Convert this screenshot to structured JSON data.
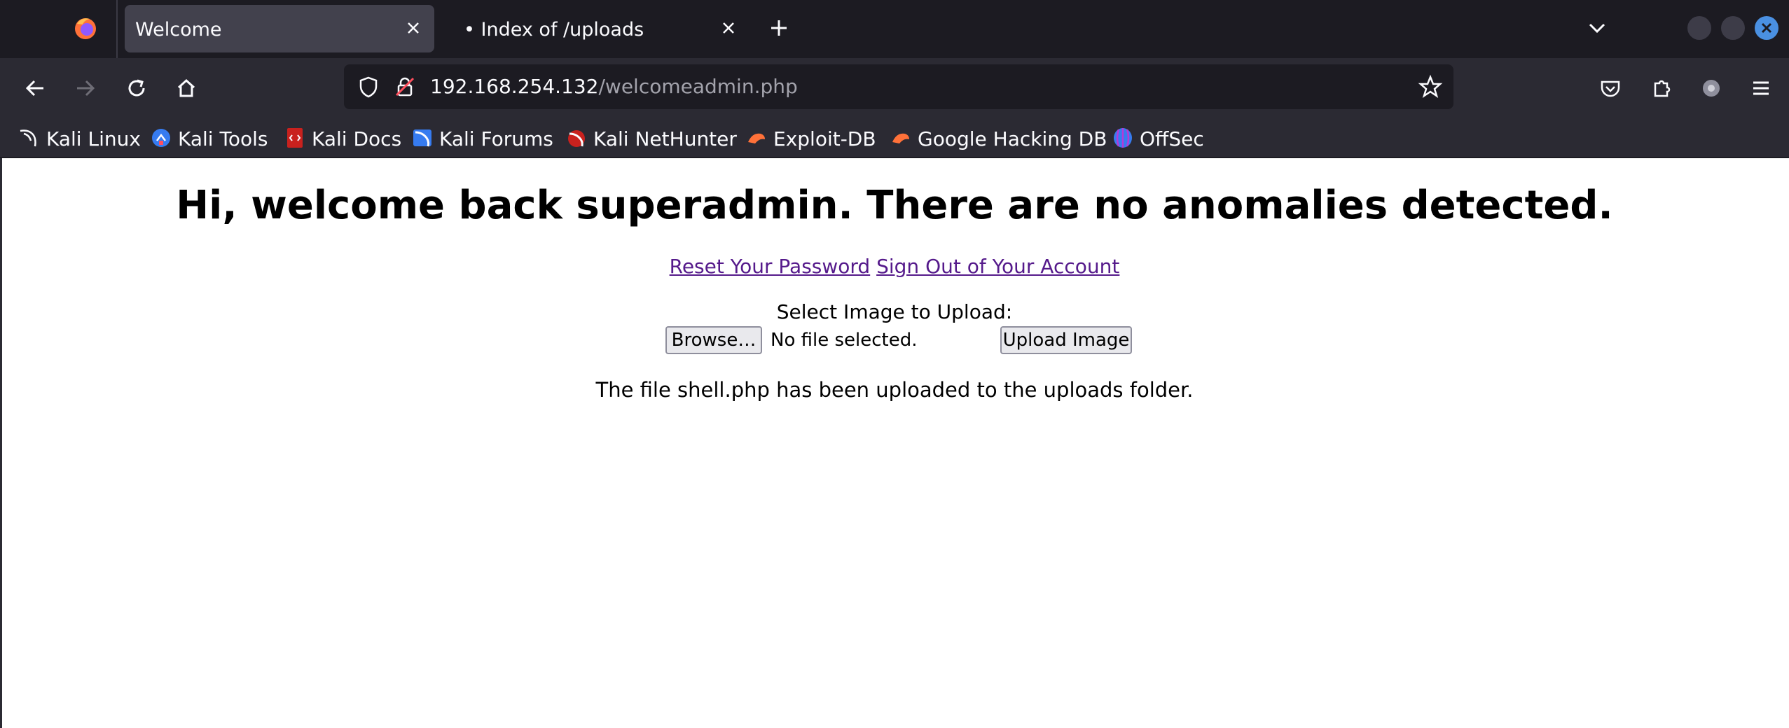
{
  "browser": {
    "tabs": [
      {
        "label": "Welcome",
        "active": true
      },
      {
        "label": "Index of /uploads",
        "active": false
      }
    ],
    "url_host": "192.168.254.132",
    "url_path": "/welcomeadmin.php",
    "bookmarks": [
      {
        "label": "Kali Linux",
        "icon": "kali-dragon-icon"
      },
      {
        "label": "Kali Tools",
        "icon": "kali-tools-icon"
      },
      {
        "label": "Kali Docs",
        "icon": "kali-docs-icon"
      },
      {
        "label": "Kali Forums",
        "icon": "kali-forums-icon"
      },
      {
        "label": "Kali NetHunter",
        "icon": "kali-nethunter-icon"
      },
      {
        "label": "Exploit-DB",
        "icon": "exploit-db-icon"
      },
      {
        "label": "Google Hacking DB",
        "icon": "ghdb-icon"
      },
      {
        "label": "OffSec",
        "icon": "offsec-icon"
      }
    ],
    "colors": {
      "tabstrip": "#1c1b22",
      "toolbar": "#2b2a33",
      "active_tab": "#42414d",
      "close_window": "#4a90e2"
    }
  },
  "page": {
    "heading": "Hi, welcome back superadmin. There are no anomalies detected.",
    "links": {
      "reset": "Reset Your Password",
      "signout": "Sign Out of Your Account"
    },
    "upload": {
      "label": "Select Image to Upload:",
      "browse_label": "Browse…",
      "file_status": "No file selected.",
      "submit_label": "Upload Image"
    },
    "result_message": "The file shell.php has been uploaded to the uploads folder.",
    "colors": {
      "visited_link": "#551a8b"
    }
  }
}
